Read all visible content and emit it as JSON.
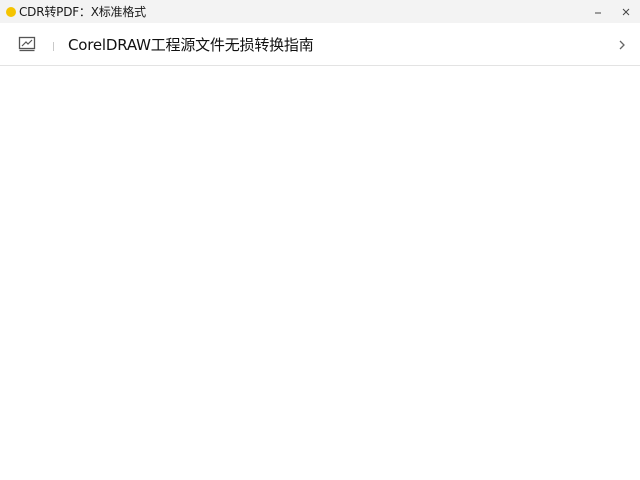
{
  "window": {
    "title": "CDR转PDF：X标准格式",
    "accent_color": "#f5c400",
    "icon": "app-dot-icon"
  },
  "controls": {
    "minimize_icon": "minimize-icon",
    "close_icon": "close-icon"
  },
  "list": {
    "items": [
      {
        "icon": "image-frame-icon",
        "label": "CorelDRAW工程源文件无损转换指南",
        "trailing_icon": "chevron-right-icon"
      }
    ]
  }
}
